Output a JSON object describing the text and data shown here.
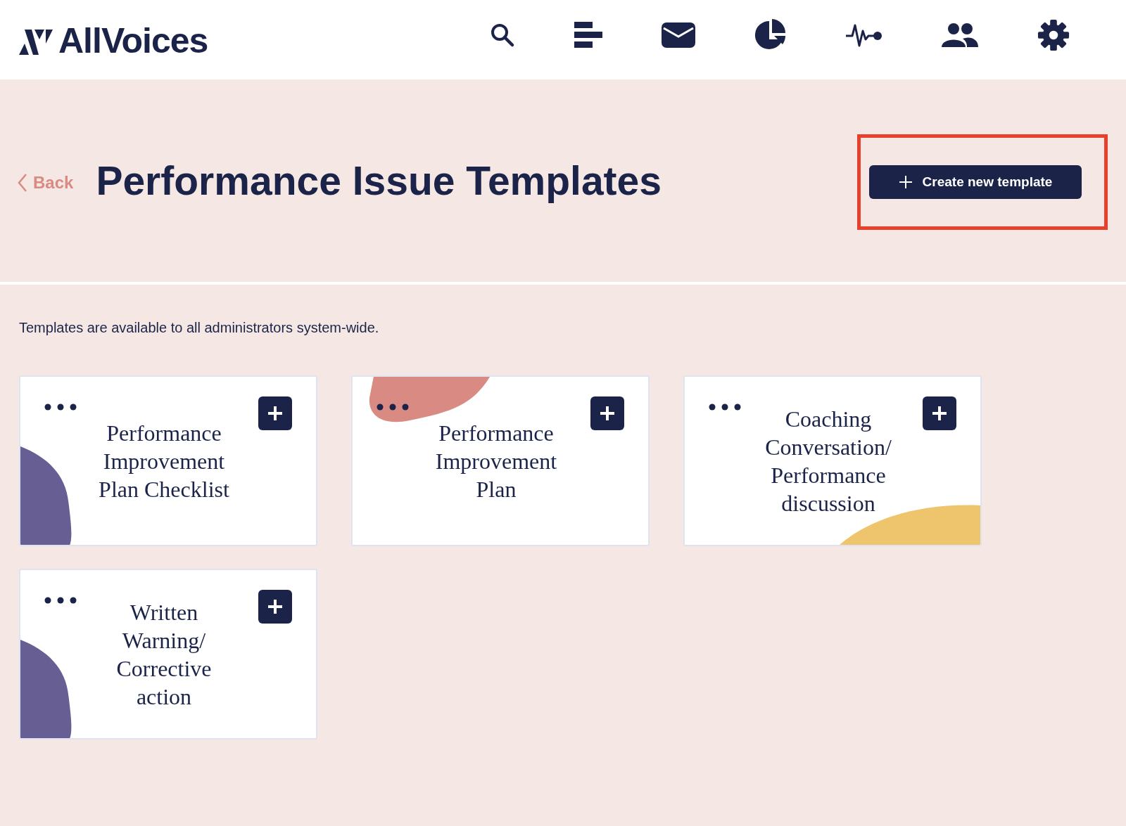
{
  "logo": {
    "name": "AllVoices"
  },
  "header": {
    "back": "Back",
    "title": "Performance Issue Templates",
    "create_button": "Create new template",
    "highlighted": true
  },
  "note": "Templates are available to all administrators system-wide.",
  "cards": [
    {
      "title": "Performance Improvement Plan Checklist",
      "accent": {
        "kind": "left",
        "color": "#675f94"
      }
    },
    {
      "title": "Performance Improvement Plan",
      "accent": {
        "kind": "top",
        "color": "#d98a82"
      }
    },
    {
      "title": "Coaching Conversation/ Performance discussion",
      "accent": {
        "kind": "bottom-right",
        "color": "#eec46c"
      }
    },
    {
      "title": "Written Warning/ Corrective action",
      "accent": {
        "kind": "left",
        "color": "#675f94"
      }
    }
  ]
}
